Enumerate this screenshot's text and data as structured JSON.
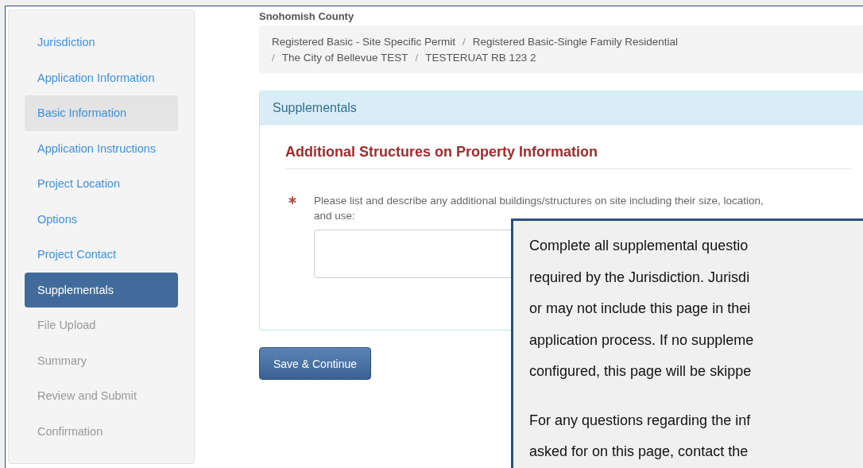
{
  "sidebar": {
    "items": [
      {
        "label": "Jurisdiction",
        "disabled": false,
        "selected": false,
        "hover": false
      },
      {
        "label": "Application Information",
        "disabled": false,
        "selected": false,
        "hover": false
      },
      {
        "label": "Basic Information",
        "disabled": false,
        "selected": false,
        "hover": true
      },
      {
        "label": "Application Instructions",
        "disabled": false,
        "selected": false,
        "hover": false
      },
      {
        "label": "Project Location",
        "disabled": false,
        "selected": false,
        "hover": false
      },
      {
        "label": "Options",
        "disabled": false,
        "selected": false,
        "hover": false
      },
      {
        "label": "Project Contact",
        "disabled": false,
        "selected": false,
        "hover": false
      },
      {
        "label": "Supplementals",
        "disabled": false,
        "selected": true,
        "hover": false
      },
      {
        "label": "File Upload",
        "disabled": true,
        "selected": false,
        "hover": false
      },
      {
        "label": "Summary",
        "disabled": true,
        "selected": false,
        "hover": false
      },
      {
        "label": "Review and Submit",
        "disabled": true,
        "selected": false,
        "hover": false
      },
      {
        "label": "Confirmation",
        "disabled": true,
        "selected": false,
        "hover": false
      }
    ]
  },
  "agency": "Snohomish County",
  "breadcrumb": {
    "separator": "/",
    "lines": [
      [
        "Registered Basic - Site Specific Permit",
        "Registered Basic-Single Family Residential"
      ],
      [
        "The City of Bellevue TEST",
        "TESTERUAT RB 123 2"
      ]
    ]
  },
  "panel": {
    "title": "Supplementals",
    "section_title": "Additional Structures on Property Information",
    "question": {
      "required": true,
      "label": "Please list and describe any additional buildings/structures on site including their size, location, and use:"
    }
  },
  "button": "Save & Continue",
  "callout": {
    "paragraphs": [
      [
        "Complete all supplemental questio",
        "required by the Jurisdiction. Jurisdi",
        "or may not include this page in thei",
        "application process. If no suppleme",
        "configured, this page will be skippe"
      ],
      [
        "For any questions regarding the inf",
        "asked for on this page, contact the"
      ]
    ]
  }
}
